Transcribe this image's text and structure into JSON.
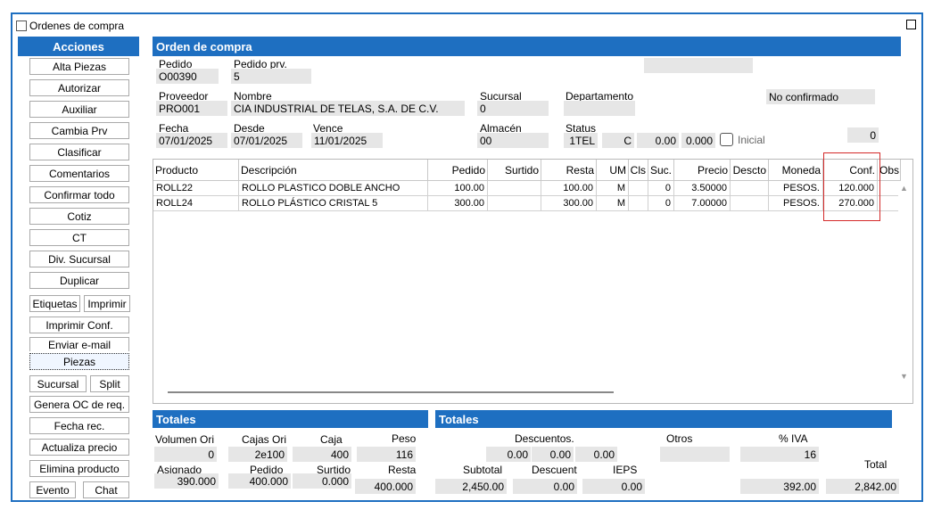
{
  "window": {
    "title": "Ordenes de compra"
  },
  "sidebar": {
    "header": "Acciones",
    "buttons": [
      "Alta Piezas",
      "Autorizar",
      "Auxiliar",
      "Cambia Prv",
      "Clasificar",
      "Comentarios",
      "Confirmar todo",
      "Cotiz",
      "CT",
      "Div. Sucursal",
      "Duplicar"
    ],
    "etiquetas": "Etiquetas",
    "imprimir": "Imprimir",
    "imprimir_conf": "Imprimir Conf.",
    "enviar_email": "Enviar e-mail",
    "piezas": "Piezas",
    "sucursal": "Sucursal",
    "split": "Split",
    "genera_oc": "Genera OC de req.",
    "fecha_rec": "Fecha rec.",
    "actualiza_precio": "Actualiza precio",
    "elimina_producto": "Elimina producto",
    "evento": "Evento",
    "chat": "Chat"
  },
  "header": {
    "title": "Orden de compra",
    "pedido_label": "Pedido",
    "pedido": "O00390",
    "pedido_prv_label": "Pedido prv.",
    "pedido_prv": "5",
    "proveedor_label": "Proveedor",
    "proveedor": "PRO001",
    "nombre_label": "Nombre",
    "nombre": "CIA INDUSTRIAL DE TELAS, S.A. DE C.V.",
    "sucursal_label": "Sucursal",
    "sucursal": "0",
    "departamento_label": "Departamento",
    "estado": "No confirmado",
    "fecha_label": "Fecha",
    "fecha": "07/01/2025",
    "desde_label": "Desde",
    "desde": "07/01/2025",
    "vence_label": "Vence",
    "vence": "11/01/2025",
    "almacen_label": "Almacén",
    "almacen": "00",
    "status_label": "Status",
    "status": "1TEL",
    "status2": "C",
    "val1": "0.00",
    "val2": "0.000",
    "inicial_label": "Inicial",
    "right_val": "0"
  },
  "grid": {
    "columns": [
      "Producto",
      "Descripción",
      "Pedido",
      "Surtido",
      "Resta",
      "UM",
      "Cls",
      "Suc.",
      "Precio",
      "Descto",
      "Moneda",
      "Conf.",
      "Obs."
    ],
    "rows": [
      {
        "producto": "ROLL22",
        "descripcion": "ROLLO PLASTICO DOBLE ANCHO",
        "pedido": "100.00",
        "surtido": "",
        "resta": "100.00",
        "um": "M",
        "cls": "",
        "suc": "0",
        "precio": "3.50000",
        "descto": "",
        "moneda": "PESOS.",
        "conf": "120.000",
        "obs": ""
      },
      {
        "producto": "ROLL24",
        "descripcion": "ROLLO PLÁSTICO CRISTAL 5",
        "pedido": "300.00",
        "surtido": "",
        "resta": "300.00",
        "um": "M",
        "cls": "",
        "suc": "0",
        "precio": "7.00000",
        "descto": "",
        "moneda": "PESOS.",
        "conf": "270.000",
        "obs": ""
      }
    ]
  },
  "totales_left": {
    "title": "Totales",
    "volumen_ori_label": "Volumen Ori",
    "volumen_ori": "0",
    "cajas_ori_label": "Cajas Ori",
    "cajas_ori": "2e100",
    "caja_label": "Caja",
    "caja": "400",
    "peso_label": "Peso",
    "peso": "116",
    "asignado_label": "Asignado",
    "asignado": "390.000",
    "pedido_label": "Pedido",
    "pedido": "400.000",
    "surtido_label": "Surtido",
    "surtido": "0.000",
    "resta_label": "Resta",
    "resta": "400.000"
  },
  "totales_right": {
    "title": "Totales",
    "descuentos_label": "Descuentos.",
    "d1": "0.00",
    "d2": "0.00",
    "d3": "0.00",
    "otros_label": "Otros",
    "iva_pct_label": "% IVA",
    "iva_pct": "16",
    "total_label": "Total",
    "subtotal_label": "Subtotal",
    "subtotal": "2,450.00",
    "descuent_label": "Descuent",
    "descuent": "0.00",
    "ieps_label": "IEPS",
    "ieps": "0.00",
    "iva": "392.00",
    "total": "2,842.00"
  }
}
